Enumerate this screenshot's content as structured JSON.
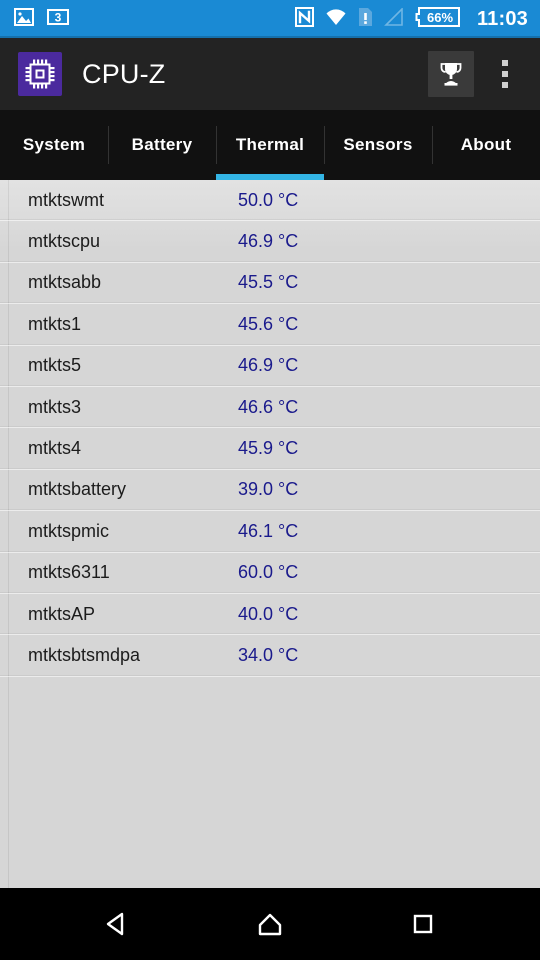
{
  "statusbar": {
    "background": "#1a8ad4",
    "left_icons": [
      {
        "name": "image-icon",
        "label": "image"
      },
      {
        "name": "three-badge-icon",
        "label": "3"
      }
    ],
    "right_icons": [
      {
        "name": "nfc-icon",
        "label": "NFC"
      },
      {
        "name": "wifi-icon",
        "label": "wifi"
      },
      {
        "name": "sim-alert-icon",
        "label": "sim-card-alert"
      },
      {
        "name": "signal-icon",
        "label": "cellular-signal"
      }
    ],
    "battery_percent": "66%",
    "time": "11:03"
  },
  "appbar": {
    "background": "#232323",
    "app_icon_name": "cpu-chip-icon",
    "app_icon_color": "#4b2a9e",
    "title": "CPU-Z",
    "trophy_button_label": "trophy",
    "overflow_button_label": "more options"
  },
  "tabs": {
    "accent": "#33b5e5",
    "active_index": 2,
    "items": [
      {
        "label": "System"
      },
      {
        "label": "Battery"
      },
      {
        "label": "Thermal"
      },
      {
        "label": "Sensors"
      },
      {
        "label": "About"
      }
    ]
  },
  "thermal": {
    "label_color": "#1c1c1c",
    "value_color": "#1a1a8c",
    "rows": [
      {
        "label": "mtktswmt",
        "value": "50.0 °C"
      },
      {
        "label": "mtktscpu",
        "value": "46.9 °C"
      },
      {
        "label": "mtktsabb",
        "value": "45.5 °C"
      },
      {
        "label": "mtkts1",
        "value": "45.6 °C"
      },
      {
        "label": "mtkts5",
        "value": "46.9 °C"
      },
      {
        "label": "mtkts3",
        "value": "46.6 °C"
      },
      {
        "label": "mtkts4",
        "value": "45.9 °C"
      },
      {
        "label": "mtktsbattery",
        "value": "39.0 °C"
      },
      {
        "label": "mtktspmic",
        "value": "46.1 °C"
      },
      {
        "label": "mtkts6311",
        "value": "60.0 °C"
      },
      {
        "label": "mtktsAP",
        "value": "40.0 °C"
      },
      {
        "label": "mtktsbtsmdpa",
        "value": "34.0 °C"
      }
    ]
  },
  "navbar": {
    "back_label": "Back",
    "home_label": "Home",
    "recents_label": "Recents"
  }
}
